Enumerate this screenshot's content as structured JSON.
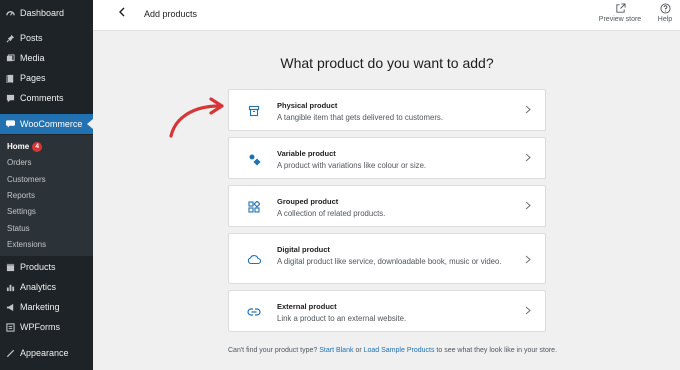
{
  "sidebar": {
    "items": [
      {
        "label": "Dashboard",
        "icon": "dashboard-icon"
      },
      {
        "label": "Posts",
        "icon": "pin-icon"
      },
      {
        "label": "Media",
        "icon": "media-icon"
      },
      {
        "label": "Pages",
        "icon": "pages-icon"
      },
      {
        "label": "Comments",
        "icon": "comment-icon"
      },
      {
        "label": "WooCommerce",
        "icon": "woo-icon"
      },
      {
        "label": "Products",
        "icon": "products-icon"
      },
      {
        "label": "Analytics",
        "icon": "analytics-icon"
      },
      {
        "label": "Marketing",
        "icon": "megaphone-icon"
      },
      {
        "label": "WPForms",
        "icon": "forms-icon"
      },
      {
        "label": "Appearance",
        "icon": "brush-icon"
      }
    ],
    "submenu": {
      "home_label": "Home",
      "home_badge": "4",
      "items": [
        "Orders",
        "Customers",
        "Reports",
        "Settings",
        "Status",
        "Extensions"
      ]
    }
  },
  "header": {
    "title": "Add products",
    "preview_label": "Preview store",
    "help_label": "Help"
  },
  "main": {
    "heading": "What product do you want to add?",
    "cards": [
      {
        "title": "Physical product",
        "desc": "A tangible item that gets delivered to customers.",
        "icon": "box-icon"
      },
      {
        "title": "Variable product",
        "desc": "A product with variations like colour or size.",
        "icon": "shapes-icon"
      },
      {
        "title": "Grouped product",
        "desc": "A collection of related products.",
        "icon": "grid-icon"
      },
      {
        "title": "Digital product",
        "desc": "A digital product like service, downloadable book, music or video.",
        "icon": "cloud-icon"
      },
      {
        "title": "External product",
        "desc": "Link a product to an external website.",
        "icon": "link-icon"
      }
    ],
    "footnote": {
      "prefix": "Can't find your product type?",
      "link1": "Start Blank",
      "middle": "or",
      "link2": "Load Sample Products",
      "suffix": "to see what they look like in your store."
    }
  },
  "colors": {
    "accent": "#2271b1",
    "sidebar_bg": "#1d2327",
    "annotation_arrow": "#d63638"
  }
}
